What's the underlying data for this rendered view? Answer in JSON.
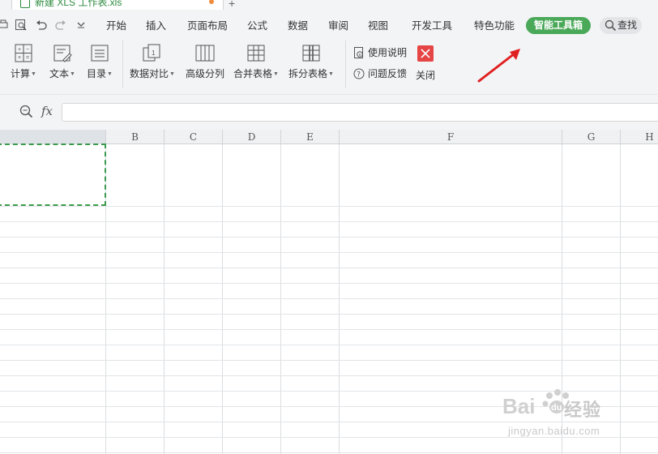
{
  "document_tab": {
    "title": "新建 XLS 工作表.xls",
    "new_tab_symbol": "+"
  },
  "menu": {
    "items": [
      "开始",
      "插入",
      "页面布局",
      "公式",
      "数据",
      "审阅",
      "视图",
      "开发工具",
      "特色功能"
    ],
    "active": "智能工具箱",
    "search_label": "查找"
  },
  "ribbon": {
    "buttons": [
      {
        "label": "计算",
        "dropdown": true,
        "icon": "calculator-icon"
      },
      {
        "label": "文本",
        "dropdown": true,
        "icon": "text-edit-icon"
      },
      {
        "label": "目录",
        "dropdown": true,
        "icon": "list-icon"
      },
      {
        "label": "数据对比",
        "dropdown": true,
        "icon": "data-compare-icon"
      },
      {
        "label": "高级分列",
        "dropdown": false,
        "icon": "split-columns-icon"
      },
      {
        "label": "合并表格",
        "dropdown": true,
        "icon": "merge-table-icon"
      },
      {
        "label": "拆分表格",
        "dropdown": true,
        "icon": "split-table-icon"
      }
    ],
    "help_label": "使用说明",
    "feedback_label": "问题反馈",
    "close_label": "关闭"
  },
  "formula_bar": {
    "fx_label": "fx",
    "value": ""
  },
  "columns": [
    "B",
    "C",
    "D",
    "E",
    "F",
    "G",
    "H"
  ],
  "watermark": {
    "text": "经验",
    "url": "jingyan.baidu.com"
  },
  "colors": {
    "accent_green": "#4aa859",
    "close_red": "#e54545",
    "arrow_red": "#e02020"
  }
}
